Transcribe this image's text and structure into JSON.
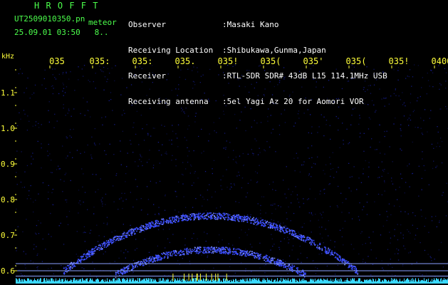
{
  "header": {
    "brand": "H R O F F T",
    "filename": "UT2509010350.pn",
    "filename_tag": "meteor",
    "datetime": "25.09.01 03:50",
    "datetime_suffix": "8..",
    "info": [
      {
        "label": "Observer",
        "value": ":Masaki Kano"
      },
      {
        "label": "Receiving Location",
        "value": ":Shibukawa,Gunma,Japan"
      },
      {
        "label": "Receiver",
        "value": ":RTL-SDR SDR# 43dB L15 114.1MHz USB"
      },
      {
        "label": "Receiving antenna",
        "value": ":5el Yagi Az 20 for Aomori VOR"
      }
    ]
  },
  "colors": {
    "background": "#000000",
    "label_green": "#4cff4c",
    "label_yellow": "#ffff3a",
    "signal_blue": "#3a4cff",
    "noise_cyan": "#3ad8ff",
    "marker_line": "#8aa0ff"
  },
  "chart_data": {
    "type": "heatmap",
    "title": "",
    "xlabel": "",
    "ylabel": "kHz",
    "x_tick_labels": [
      "035",
      "035:",
      "035:",
      "035.",
      "035!",
      "035(",
      "035'",
      "035(",
      "035!",
      "0400"
    ],
    "y_tick_labels": [
      "1.1",
      "1.0",
      "0.9",
      "0.8",
      "0.7",
      "0.6"
    ],
    "y_tick_values": [
      1.1,
      1.0,
      0.9,
      0.8,
      0.7,
      0.6
    ],
    "ylim": [
      0.58,
      1.2
    ],
    "horizontal_markers_khz": [
      0.62,
      0.6,
      0.585
    ],
    "signal_arcs": [
      {
        "name": "",
        "x_center_frac": 0.45,
        "peak_khz": 0.755,
        "base_khz": 0.6,
        "half_width_frac": 0.34
      },
      {
        "name": "",
        "x_center_frac": 0.45,
        "peak_khz": 0.66,
        "base_khz": 0.59,
        "half_width_frac": 0.22
      }
    ]
  }
}
